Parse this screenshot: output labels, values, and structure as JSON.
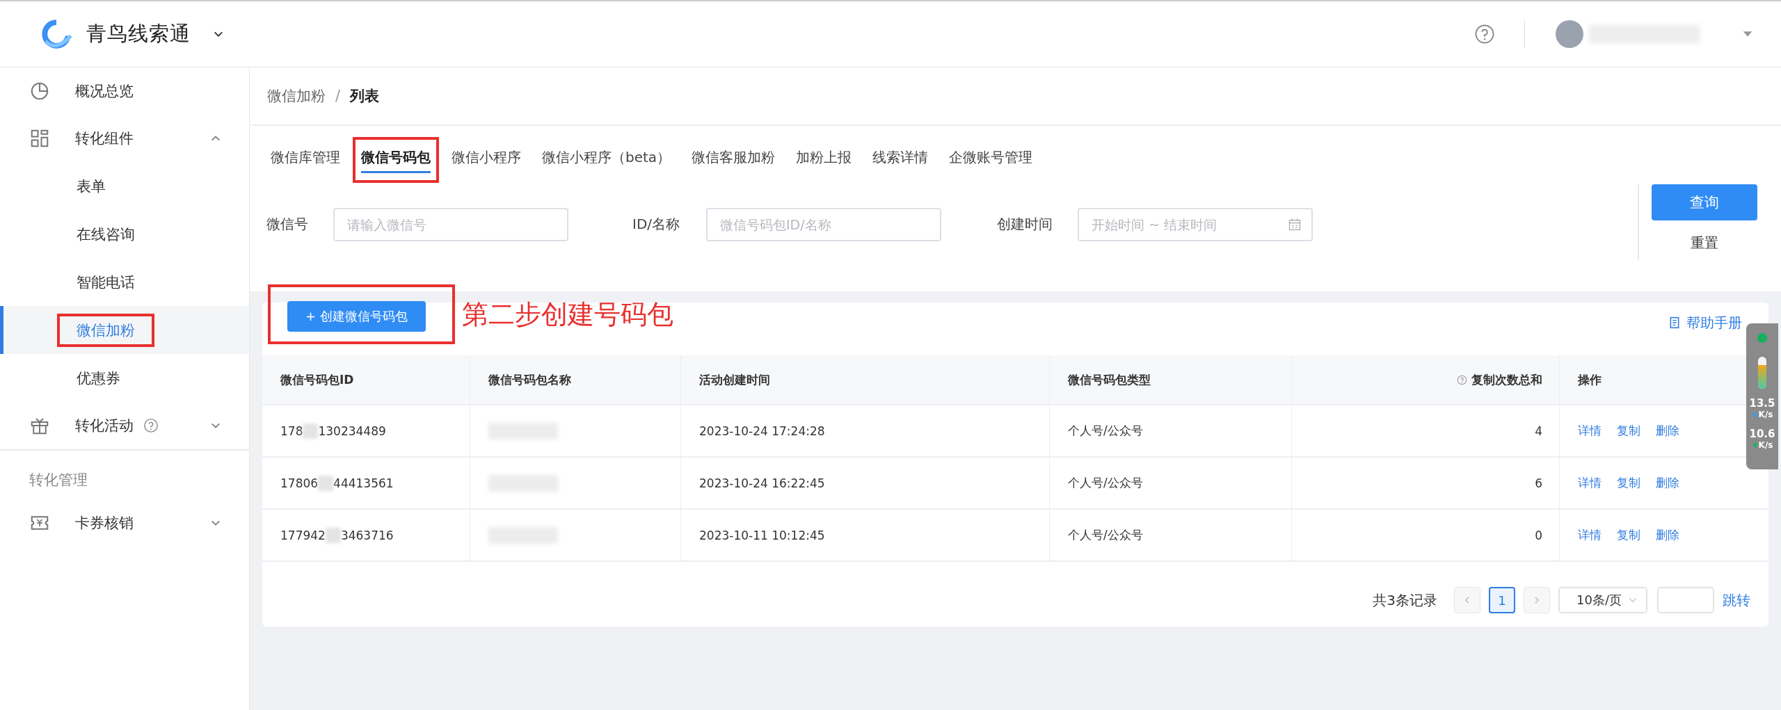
{
  "header": {
    "app_name": "青鸟线索通"
  },
  "sidebar": {
    "groups": [
      {
        "items": [
          {
            "label": "概况总览",
            "kind": "pie"
          },
          {
            "label": "转化组件",
            "kind": "grid",
            "expanded": true,
            "children": [
              {
                "label": "表单",
                "selected": false,
                "highlighted": false
              },
              {
                "label": "在线咨询",
                "selected": false,
                "highlighted": false
              },
              {
                "label": "智能电话",
                "selected": false,
                "highlighted": false
              },
              {
                "label": "微信加粉",
                "selected": true,
                "highlighted": true
              },
              {
                "label": "优惠券",
                "selected": false,
                "highlighted": false
              }
            ]
          },
          {
            "label": "转化活动",
            "kind": "gift",
            "help": true,
            "expanded": false
          }
        ]
      },
      {
        "title": "转化管理",
        "items": [
          {
            "label": "卡券核销",
            "kind": "ticket",
            "expanded": false
          }
        ]
      }
    ]
  },
  "breadcrumb": {
    "separator": "/",
    "items": [
      "微信加粉",
      "列表"
    ]
  },
  "tabs": [
    {
      "label": "微信库管理",
      "selected": false,
      "highlighted": false
    },
    {
      "label": "微信号码包",
      "selected": true,
      "highlighted": true
    },
    {
      "label": "微信小程序",
      "selected": false,
      "highlighted": false
    },
    {
      "label": "微信小程序（beta）",
      "selected": false,
      "highlighted": false
    },
    {
      "label": "微信客服加粉",
      "selected": false,
      "highlighted": false
    },
    {
      "label": "加粉上报",
      "selected": false,
      "highlighted": false
    },
    {
      "label": "线索详情",
      "selected": false,
      "highlighted": false
    },
    {
      "label": "企微账号管理",
      "selected": false,
      "highlighted": false
    }
  ],
  "filters": [
    {
      "label": "微信号",
      "placeholder": "请输入微信号",
      "kind": "text"
    },
    {
      "label": "ID/名称",
      "placeholder": "微信号码包ID/名称",
      "kind": "text"
    },
    {
      "label": "创建时间",
      "placeholder": "开始时间 ~ 结束时间",
      "kind": "daterange"
    }
  ],
  "query_button": "查询",
  "reset_button": "重置",
  "create_button": {
    "label": "+ 创建微信号码包",
    "highlighted": true
  },
  "annotation": "第二步创建号码包",
  "help_link": "帮助手册",
  "table": {
    "columns": [
      {
        "label": "微信号码包ID",
        "kind": "text"
      },
      {
        "label": "微信号码包名称",
        "kind": "text"
      },
      {
        "label": "活动创建时间",
        "kind": "text"
      },
      {
        "label": "微信号码包类型",
        "kind": "text"
      },
      {
        "label": "复制次数总和",
        "kind": "number",
        "help": true
      },
      {
        "label": "操作",
        "kind": "actions"
      }
    ],
    "rows": [
      {
        "id_start": "178",
        "id_end": "130234489",
        "time": "2023-10-24 17:24:28",
        "type": "个人号/公众号",
        "count": "4",
        "actions": [
          "详情",
          "复制",
          "删除"
        ]
      },
      {
        "id_start": "17806",
        "id_end": "44413561",
        "time": "2023-10-24 16:22:45",
        "type": "个人号/公众号",
        "count": "6",
        "actions": [
          "详情",
          "复制",
          "删除"
        ]
      },
      {
        "id_start": "177942",
        "id_end": "3463716",
        "time": "2023-10-11 10:12:45",
        "type": "个人号/公众号",
        "count": "0",
        "actions": [
          "详情",
          "复制",
          "删除"
        ]
      }
    ]
  },
  "pagination": {
    "total": "共3条记录",
    "pages": [
      {
        "label": "1",
        "selected": true
      }
    ],
    "page_size": "10条/页",
    "jump": "跳转"
  },
  "net_monitor": {
    "level": 0.75,
    "up": "13.5",
    "up_unit": "K/s",
    "down": "10.6",
    "down_unit": "K/s"
  }
}
